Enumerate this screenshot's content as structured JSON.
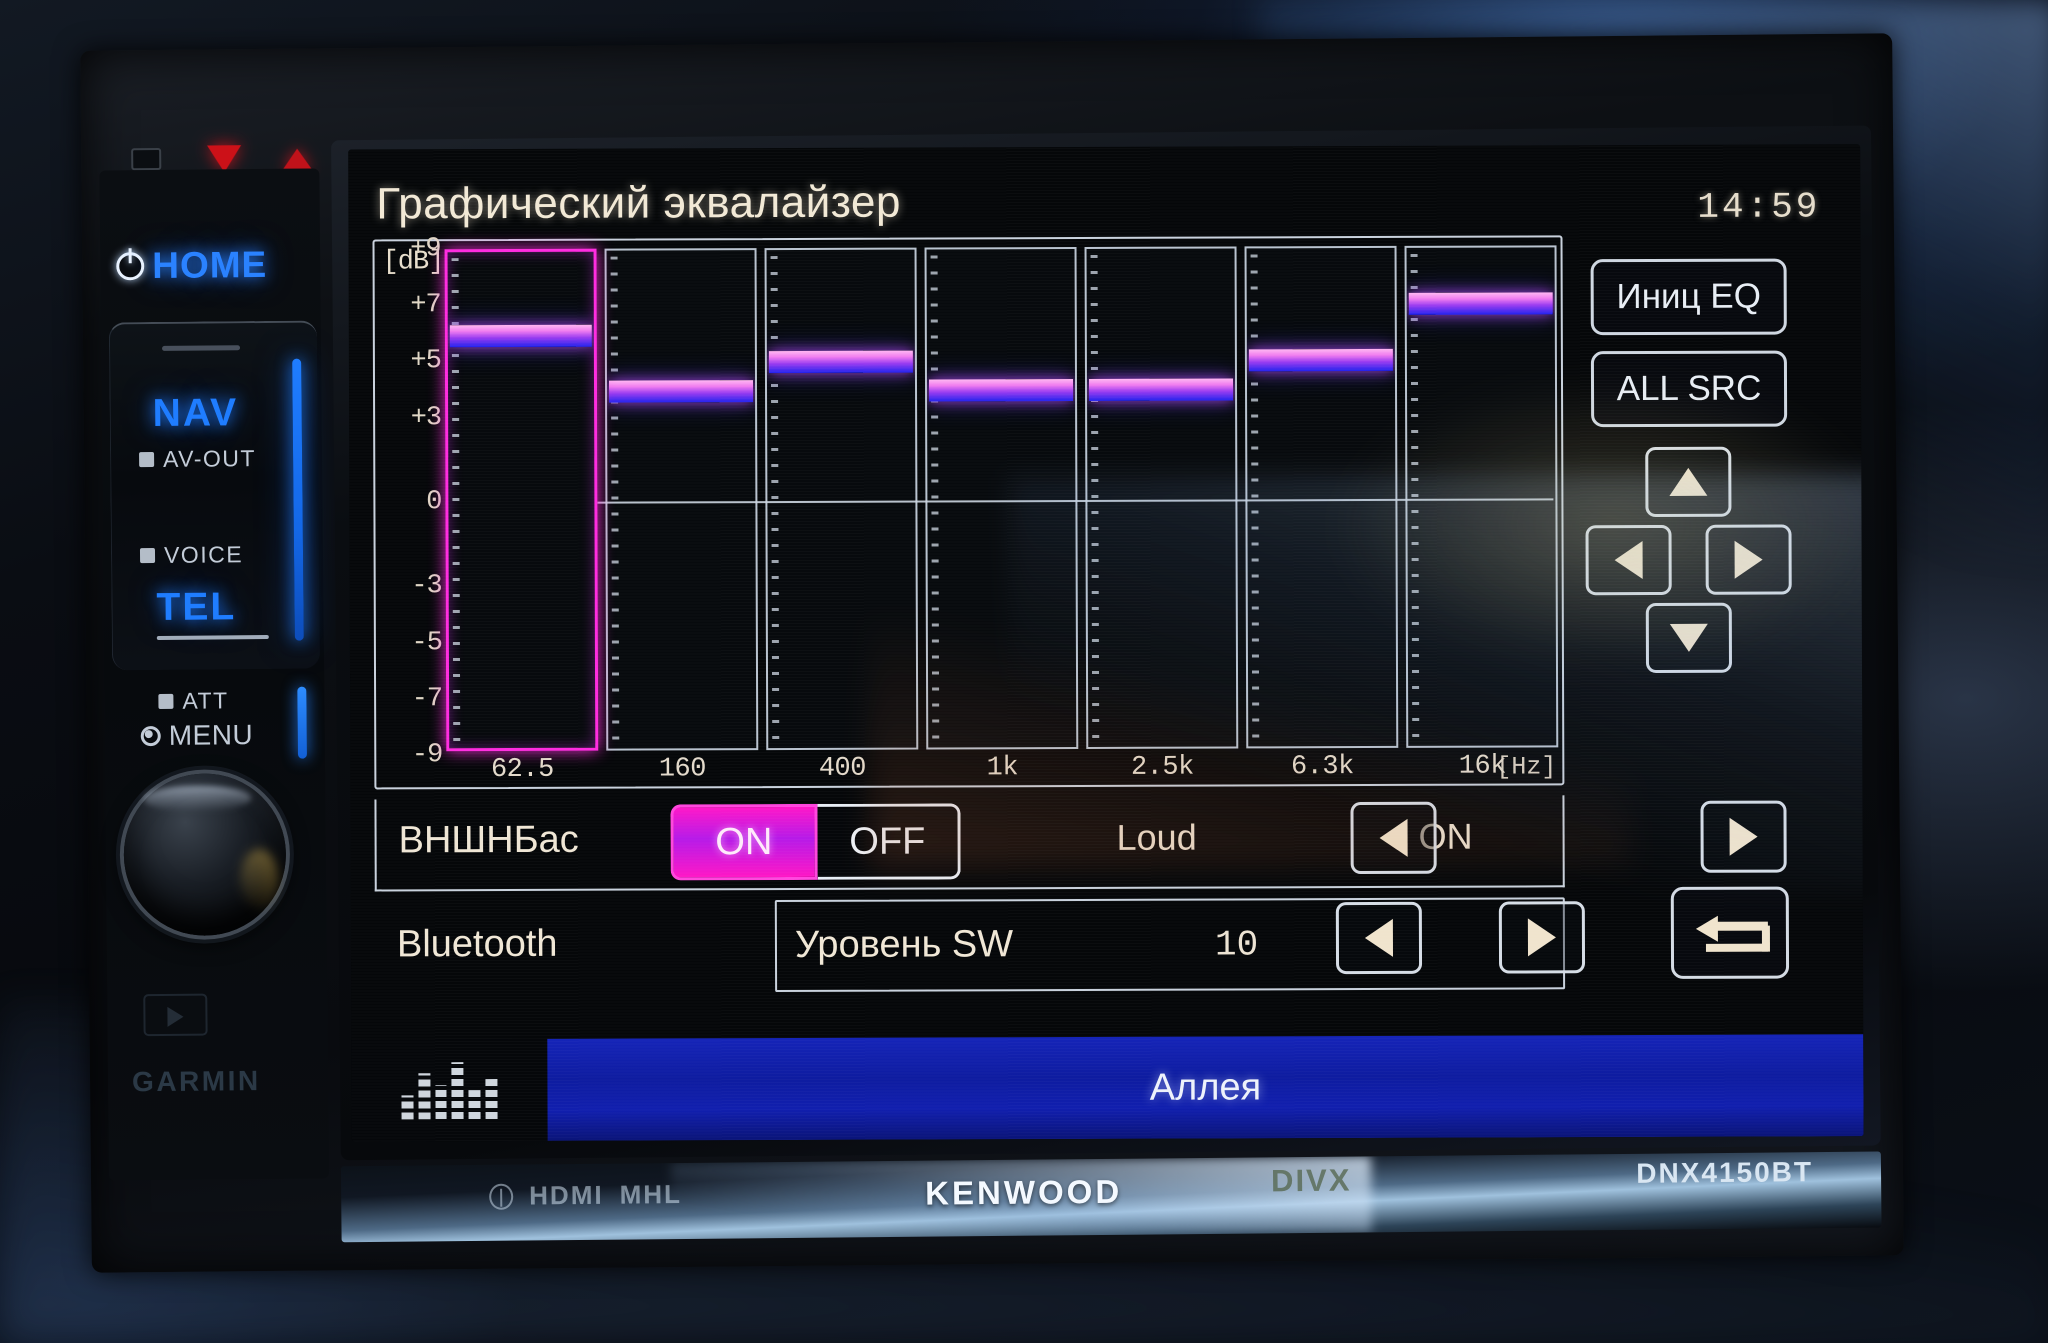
{
  "device": {
    "brand": "KENWOOD",
    "model": "DNX4150BT",
    "codec_logo": "DIVX",
    "bottom_logos": [
      "HDMI",
      "MHL"
    ],
    "partner_logo": "GARMIN"
  },
  "hardware_buttons": {
    "home": {
      "label": "HOME",
      "icon": "power-icon"
    },
    "nav": {
      "label": "NAV"
    },
    "av_out": {
      "label": "AV-OUT"
    },
    "voice": {
      "label": "VOICE"
    },
    "tel": {
      "label": "TEL"
    },
    "att": {
      "label": "ATT"
    },
    "menu": {
      "label": "MENU"
    }
  },
  "screen": {
    "title": "Графический эквалайзер",
    "clock": "14:59",
    "buttons": {
      "init_eq": "Иниц EQ",
      "all_src": "ALL SRC"
    },
    "nav_pad": {
      "up": "up-arrow-icon",
      "down": "down-arrow-icon",
      "left": "left-arrow-icon",
      "right": "right-arrow-icon"
    },
    "bass_ext": {
      "label": "ВНШНБас",
      "options": [
        "ON",
        "OFF"
      ],
      "selected": "ON"
    },
    "loudness": {
      "label": "Loud",
      "value": "ON"
    },
    "bluetooth": {
      "label": "Bluetooth"
    },
    "sw_level": {
      "label": "Уровень SW",
      "value": "10"
    },
    "return_button": "return-arrow-icon",
    "source_bar": {
      "icon": "equalizer-bars-icon",
      "title": "Аллея"
    }
  },
  "chart_data": {
    "type": "bar",
    "title": "Графический эквалайзер",
    "xlabel": "[Hz]",
    "ylabel": "[dB]",
    "ylim": [
      -9,
      9
    ],
    "ytick_labels": [
      "+9",
      "+7",
      "+5",
      "+3",
      "0",
      "-3",
      "-5",
      "-7",
      "-9"
    ],
    "ytick_values": [
      9,
      7,
      5,
      3,
      0,
      -3,
      -5,
      -7,
      -9
    ],
    "categories": [
      "62.5",
      "160",
      "400",
      "1k",
      "2.5k",
      "6.3k",
      "16k"
    ],
    "values": [
      6,
      4,
      5,
      4,
      4,
      5,
      7
    ],
    "selected_index": 0,
    "grid": false,
    "legend": "none"
  }
}
